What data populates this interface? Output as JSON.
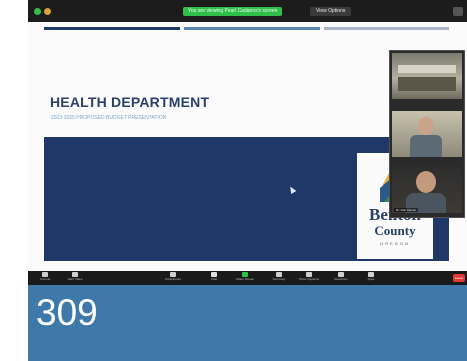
{
  "app": {
    "share_banner": "You are viewing Pearl Cadanos's screen",
    "view_options_label": "View Options"
  },
  "slide": {
    "title": "HEALTH DEPARTMENT",
    "subtitle": "2023-2025 PROPOSED BUDGET PRESENTATION",
    "accent_colors": [
      "#1f3867",
      "#5b86b5",
      "#a9b7c8"
    ],
    "logo": {
      "line1": "Benton",
      "line2": "County",
      "line3": "OREGON"
    }
  },
  "gallery": {
    "tiles": [
      {
        "name": ""
      },
      {
        "name": ""
      },
      {
        "name": "Dr. Dan Alonso"
      }
    ]
  },
  "toolbar": {
    "items": [
      {
        "label": "Unmute",
        "icon": "microphone-icon"
      },
      {
        "label": "Start Video",
        "icon": "video-camera-icon"
      },
      {
        "label": "Participants",
        "icon": "participants-icon"
      },
      {
        "label": "Chat",
        "icon": "chat-icon"
      },
      {
        "label": "Share Screen",
        "icon": "share-screen-icon"
      },
      {
        "label": "Summary",
        "icon": "summary-icon"
      },
      {
        "label": "Show Captions",
        "icon": "captions-icon"
      },
      {
        "label": "Reactions",
        "icon": "reactions-icon"
      },
      {
        "label": "Apps",
        "icon": "apps-icon"
      }
    ],
    "leave_label": "Leave"
  },
  "caption": {
    "number": "309"
  }
}
